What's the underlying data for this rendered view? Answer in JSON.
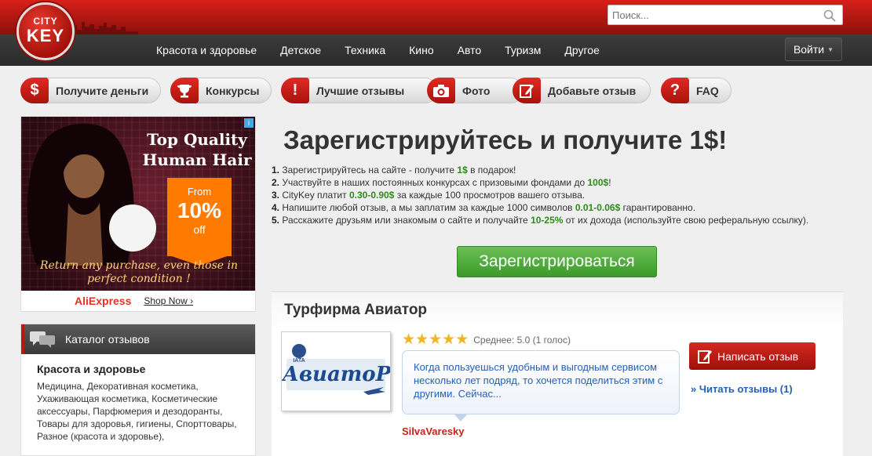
{
  "header": {
    "logo_top": "CITY",
    "logo_bottom": "KEY",
    "search_placeholder": "Поиск...",
    "nav": [
      "Красота и здоровье",
      "Детское",
      "Техника",
      "Кино",
      "Авто",
      "Туризм",
      "Другое"
    ],
    "login": "Войти"
  },
  "buttons": [
    {
      "icon": "$",
      "label": "Получите деньги"
    },
    {
      "icon": "trophy",
      "label": "Конкурсы"
    },
    {
      "icon": "!",
      "label": "Лучшие отзывы"
    },
    {
      "icon": "camera",
      "label": "Фото"
    },
    {
      "icon": "pencil",
      "label": "Добавьте отзыв"
    },
    {
      "icon": "?",
      "label": "FAQ"
    }
  ],
  "ad": {
    "title": "Top Quality Human Hair",
    "from": "From",
    "percent": "10%",
    "off": "off",
    "tagline": "Return any purchase, even those in perfect condition !",
    "brand": "AliExpress",
    "shop": "Shop Now ›"
  },
  "catalog": {
    "header": "Каталог отзывов",
    "section": "Красота и здоровье",
    "items": "Медицина, Декоративная косметика, Ухаживающая косметика, Косметические аксессуары, Парфюмерия и дезодоранты, Товары для здоровья, гигиены, Спорттовары, Разное (красота и здоровье),"
  },
  "promo": {
    "title": "Зарегистрируйтесь и получите 1$!",
    "steps": [
      {
        "n": "1.",
        "pre": " Зарегистрируйтесь на сайте - получите ",
        "hl": "1$",
        "post": " в подарок!"
      },
      {
        "n": "2.",
        "pre": " Участвуйте в наших постоянных конкурсах с призовыми фондами до ",
        "hl": "100$",
        "post": "!"
      },
      {
        "n": "3.",
        "pre": " CityKey платит ",
        "hl": "0.30-0.90$",
        "post": " за каждые 100 просмотров вашего отзыва."
      },
      {
        "n": "4.",
        "pre": " Напишите любой отзыв, а мы заплатим за каждые 1000 символов ",
        "hl": "0.01-0.06$",
        "post": " гарантированно."
      },
      {
        "n": "5.",
        "pre": " Расскажите друзьям или знакомым о сайте и получайте ",
        "hl": "10-25%",
        "post": " от их дохода (используйте свою реферальную ссылку)."
      }
    ],
    "register": "Зарегистрироваться"
  },
  "company": {
    "name": "Турфирма Авиатор",
    "logo_text": "АвиатоР",
    "logo_badge": "IATA",
    "rating": 5,
    "rating_text": "Среднее: 5.0 (1 голос)",
    "review": "Когда пользуешься удобным и выгодным сервисом несколько лет подряд, то хочется поделиться этим с другими. Сейчас...",
    "author": "SilvaVaresky",
    "write": "Написать отзыв",
    "read": "» Читать отзывы (1)"
  },
  "colors": {
    "brand_red": "#c0261d",
    "green": "#3c9a2a",
    "link_blue": "#2460b5",
    "star": "#f0b51f"
  }
}
